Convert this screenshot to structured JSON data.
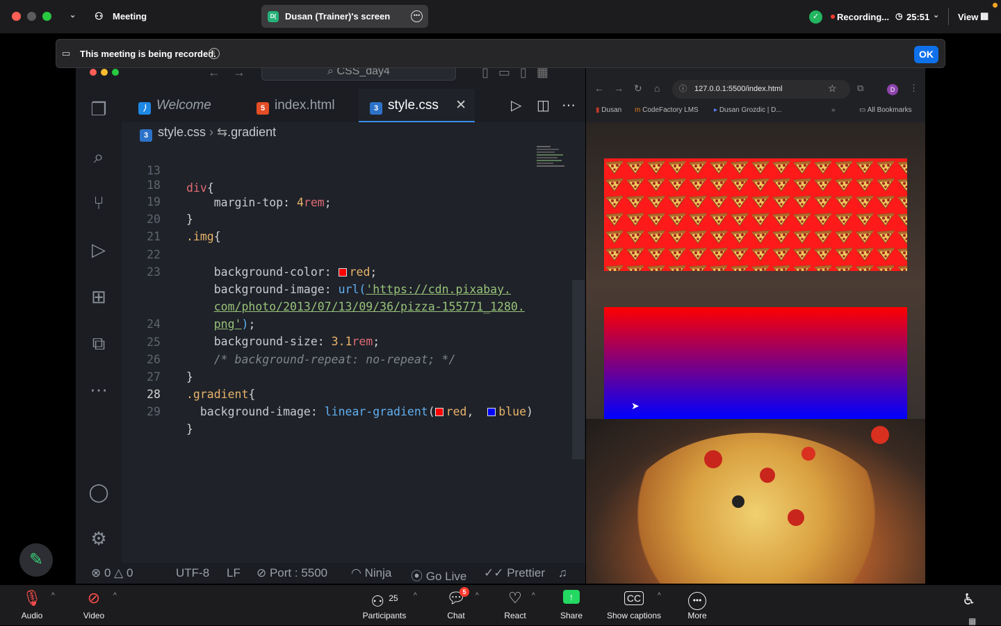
{
  "topbar": {
    "meeting_label": "Meeting",
    "screen_share_label": "Dusan (Trainer)'s screen",
    "screen_avatar": "D(",
    "recording_label": "Recording...",
    "timer": "25:51",
    "view_label": "View"
  },
  "notice": {
    "text": "This meeting is being recorded.",
    "ok_label": "OK"
  },
  "vscode": {
    "title": "CSS_day4",
    "tabs": [
      {
        "label": "Welcome",
        "icon": "vscode-icon"
      },
      {
        "label": "index.html",
        "icon": "html5-icon"
      },
      {
        "label": "style.css",
        "icon": "css3-icon",
        "active": true
      }
    ],
    "breadcrumb_file": "style.css",
    "breadcrumb_symbol": ".gradient",
    "lines": [
      {
        "n": "13",
        "code": "div{"
      },
      {
        "n": "18",
        "code": "    margin-top: 4rem;"
      },
      {
        "n": "19",
        "code": "}"
      },
      {
        "n": "20",
        "code": ".img{"
      },
      {
        "n": "21",
        "code": ""
      },
      {
        "n": "22",
        "code": "    background-color: red;"
      },
      {
        "n": "23",
        "code": "    background-image: url('https://cdn.pixabay."
      },
      {
        "n": "",
        "code": "    com/photo/2013/07/13/09/36/pizza-155771_1280."
      },
      {
        "n": "",
        "code": "    png');"
      },
      {
        "n": "24",
        "code": "    background-size: 3.1rem;"
      },
      {
        "n": "25",
        "code": "    /* background-repeat: no-repeat; */"
      },
      {
        "n": "26",
        "code": "}"
      },
      {
        "n": "27",
        "code": ".gradient{"
      },
      {
        "n": "28",
        "code": "  background-image: linear-gradient( red,  blue)"
      },
      {
        "n": "29",
        "code": "}"
      }
    ],
    "status": {
      "errors": "0",
      "warnings": "0",
      "encoding": "UTF-8",
      "eol": "LF",
      "port": "Port : 5500",
      "ninja": "Ninja",
      "go_live": "Go Live",
      "prettier": "Prettier"
    }
  },
  "browser": {
    "url": "127.0.0.1:5500/index.html",
    "profile_initial": "D",
    "bookmarks": [
      "Dusan",
      "CodeFactory LMS",
      "Dusan Grozdic | D...",
      "All Bookmarks"
    ]
  },
  "bottombar": {
    "audio": "Audio",
    "video": "Video",
    "participants": "Participants",
    "participants_count": "25",
    "chat": "Chat",
    "chat_badge": "5",
    "react": "React",
    "share": "Share",
    "captions": "Show captions",
    "more": "More"
  },
  "colors": {
    "accent_blue": "#0e71eb",
    "share_green": "#23d962",
    "recording_red": "#ff3b30",
    "gradient_start": "red",
    "gradient_end": "blue"
  }
}
